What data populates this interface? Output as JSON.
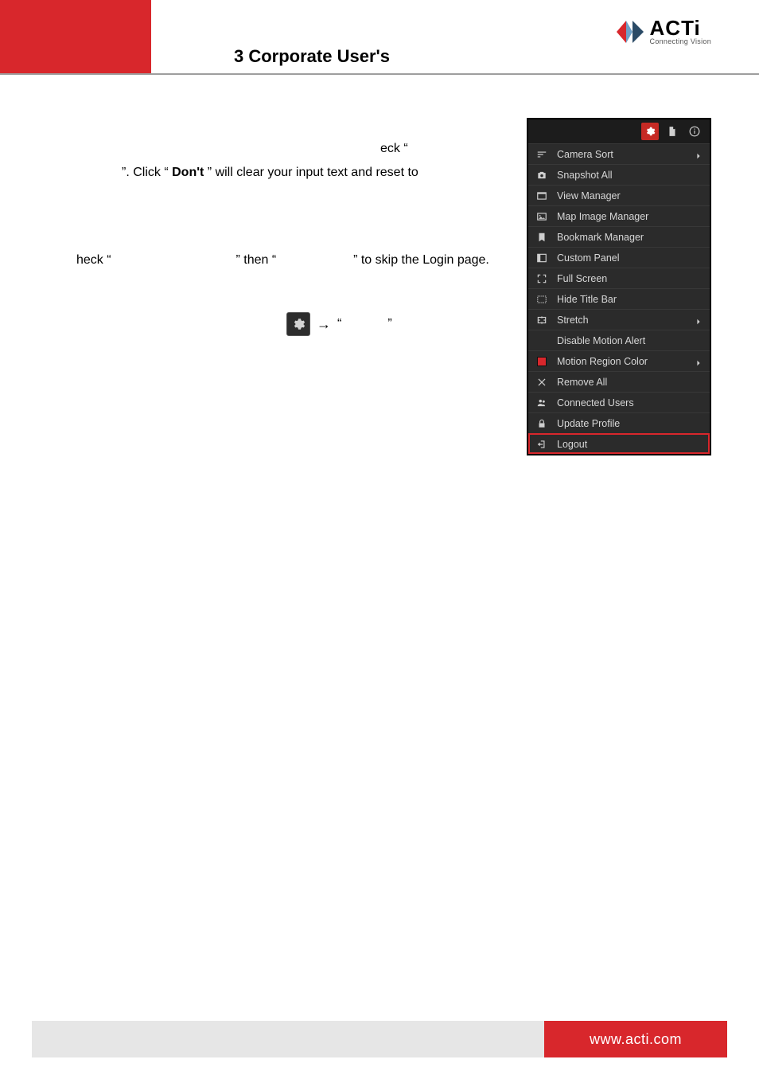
{
  "header": {
    "title": "3 Corporate User's",
    "logo_name": "ACTi",
    "logo_tagline": "Connecting Vision"
  },
  "body": {
    "line1": "eck  “",
    "line2_pre": "”. Click “",
    "line2_bold": "Don't",
    "line2_post": "” will clear your input text and reset to",
    "line3_a": "heck  “",
    "line3_b": "” then “",
    "line3_c": "” to skip the Login page.",
    "gear_line": {
      "arrow": "→",
      "open_quote": "“",
      "close_quote": "”"
    }
  },
  "menu": {
    "tabs": {
      "gear": "gear",
      "doc": "document",
      "info": "info"
    },
    "items": [
      {
        "icon": "sort",
        "label": "Camera Sort",
        "submenu": true
      },
      {
        "icon": "camera",
        "label": "Snapshot All"
      },
      {
        "icon": "window",
        "label": "View Manager"
      },
      {
        "icon": "image",
        "label": "Map Image Manager"
      },
      {
        "icon": "bookmark",
        "label": "Bookmark Manager"
      },
      {
        "icon": "panel",
        "label": "Custom Panel"
      },
      {
        "icon": "expand",
        "label": "Full Screen"
      },
      {
        "icon": "hidebar",
        "label": "Hide Title Bar"
      },
      {
        "icon": "stretch",
        "label": "Stretch",
        "submenu": true
      },
      {
        "icon": "none",
        "label": "Disable Motion Alert"
      },
      {
        "icon": "swatch",
        "label": "Motion Region Color",
        "submenu": true
      },
      {
        "icon": "close",
        "label": "Remove All"
      },
      {
        "icon": "users",
        "label": "Connected Users"
      },
      {
        "icon": "lock",
        "label": "Update Profile"
      },
      {
        "icon": "logout",
        "label": "Logout",
        "highlight": true
      }
    ]
  },
  "footer": {
    "url": "www.acti.com"
  }
}
